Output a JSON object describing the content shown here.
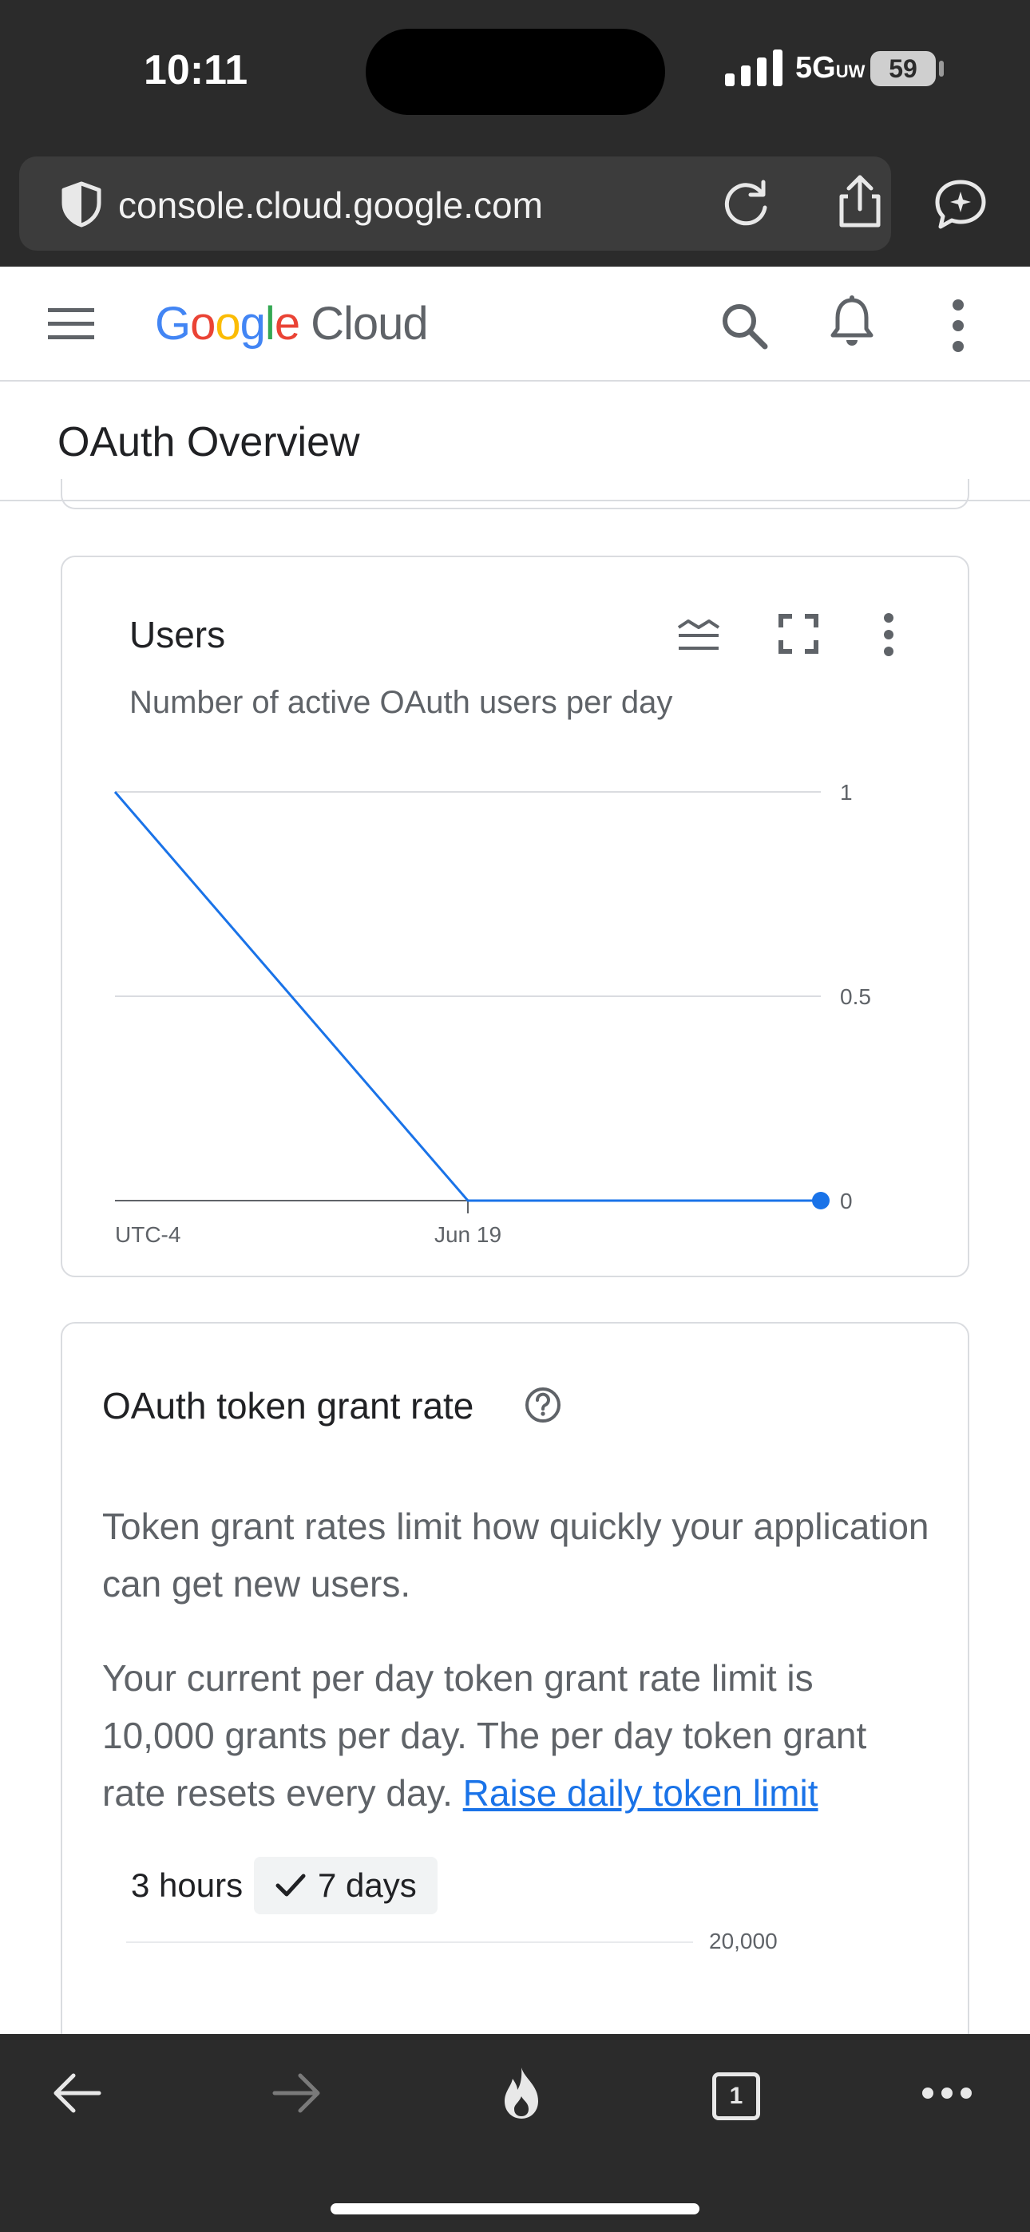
{
  "status_bar": {
    "time": "10:11",
    "network": "5G",
    "network_sup": "UW",
    "battery": "59"
  },
  "browser": {
    "url": "console.cloud.google.com"
  },
  "header": {
    "logo_google": [
      "G",
      "o",
      "o",
      "g",
      "l",
      "e"
    ],
    "logo_product": "Cloud"
  },
  "page": {
    "title": "OAuth Overview"
  },
  "users_card": {
    "title": "Users",
    "subtitle": "Number of active OAuth users per day",
    "timezone_label": "UTC-4"
  },
  "chart_data": {
    "type": "line",
    "title": "Users",
    "subtitle": "Number of active OAuth users per day",
    "x_tick_labels": [
      "Jun 19"
    ],
    "y_ticks": [
      "0",
      "0.5",
      "1"
    ],
    "ylim": [
      0,
      1
    ],
    "grid": true,
    "x": [
      0,
      0.5,
      1
    ],
    "series": [
      {
        "values": [
          1,
          0,
          0
        ],
        "color": "#1a73e8"
      }
    ]
  },
  "token_card": {
    "title": "OAuth token grant rate",
    "paragraph1": "Token grant rates limit how quickly your application can get new users.",
    "paragraph2": "Your current per day token grant rate limit is 10,000 grants per day. The per day token grant rate resets every day.",
    "raise_link": "Raise daily token limit",
    "range_3h": "3 hours",
    "range_7d": "7 days",
    "axis_top_label": "20,000"
  },
  "toolbar": {
    "tab_count": "1"
  },
  "colors": {
    "chrome_bg": "#2b2b2b",
    "accent": "#1a73e8",
    "border": "#dadce0"
  }
}
